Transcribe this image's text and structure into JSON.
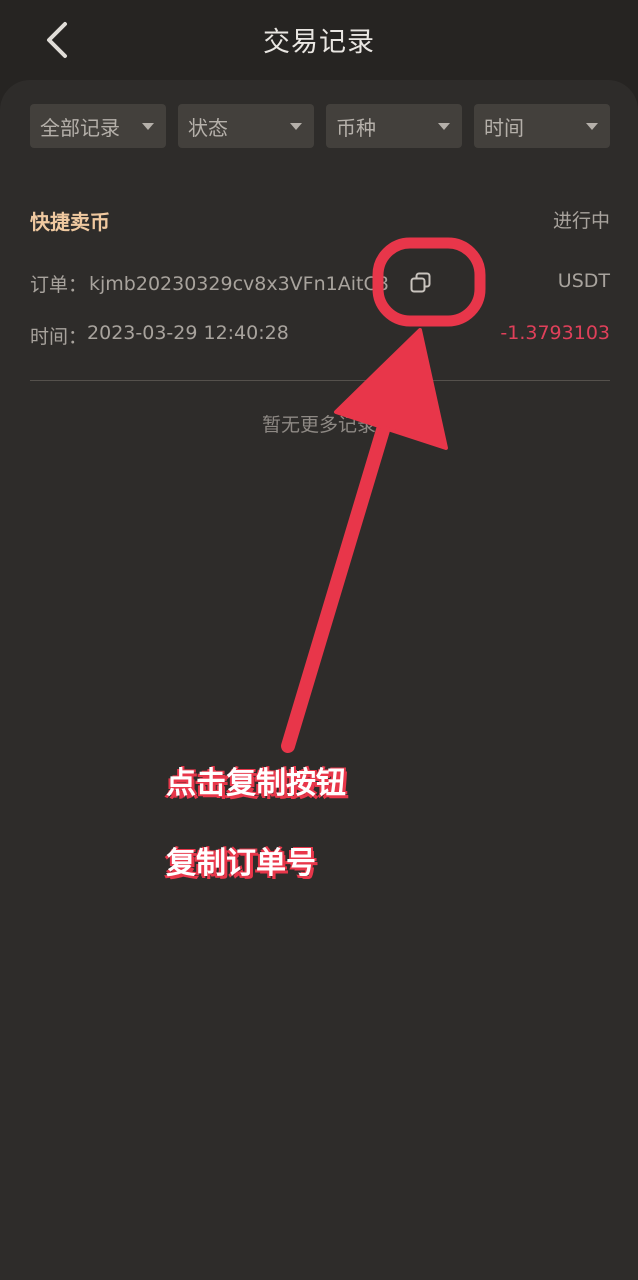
{
  "header": {
    "title": "交易记录",
    "back_icon": "chevron-left-icon"
  },
  "filters": [
    {
      "label": "全部记录"
    },
    {
      "label": "状态"
    },
    {
      "label": "币种"
    },
    {
      "label": "时间"
    }
  ],
  "record": {
    "type": "快捷卖币",
    "status": "进行中",
    "order_label": "订单：",
    "order_no": "kjmb20230329cv8x3VFn1AitC8",
    "currency": "USDT",
    "time_label": "时间：",
    "time_value": "2023-03-29 12:40:28",
    "amount": "-1.3793103"
  },
  "footer": {
    "no_more": "暂无更多记录"
  },
  "annotation": {
    "line1": "点击复制按钮",
    "line2": "复制订单号",
    "color": "#e8364a"
  },
  "colors": {
    "background": "#262422",
    "panel": "#2e2c2a",
    "accent": "#f0c9a0",
    "negative": "#e0405a"
  }
}
